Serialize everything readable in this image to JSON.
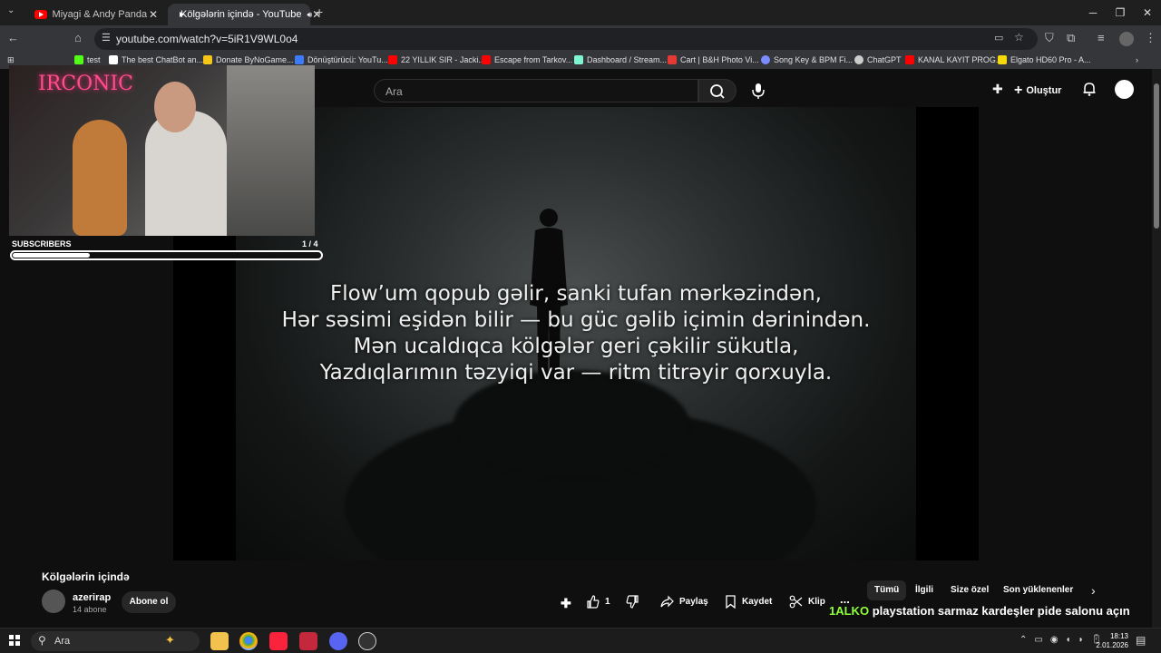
{
  "browser": {
    "tabs": [
      {
        "label": "Miyagi & Andy Panda - Minor |",
        "active": false
      },
      {
        "label": "Kölgələrin içində - YouTube",
        "active": true
      }
    ],
    "new_tab": "+",
    "url": "youtube.com/watch?v=5iR1V9WL0o4",
    "bookmarks": [
      {
        "label": "test",
        "icon": "kick-icon",
        "color": "#53fc18"
      },
      {
        "label": "The best ChatBot an...",
        "icon": "diamond-icon",
        "color": "#ffffff"
      },
      {
        "label": "Donate ByNoGame...",
        "icon": "bynogame-icon",
        "color": "#f5c518"
      },
      {
        "label": "Dönüştürücü: YouTu...",
        "icon": "converter-icon",
        "color": "#3d7bfd"
      },
      {
        "label": "22 YILLIK SIR - Jacki...",
        "icon": "youtube-icon",
        "color": "#ff0000"
      },
      {
        "label": "Escape from Tarkov...",
        "icon": "youtube-icon",
        "color": "#ff0000"
      },
      {
        "label": "Dashboard / Stream...",
        "icon": "streamlabs-icon",
        "color": "#80f5d2"
      },
      {
        "label": "Cart | B&H Photo Vi...",
        "icon": "bh-icon",
        "color": "#e53935"
      },
      {
        "label": "Song Key & BPM Fi...",
        "icon": "music-icon",
        "color": "#7a8cff"
      },
      {
        "label": "ChatGPT",
        "icon": "openai-icon",
        "color": "#cccccc"
      },
      {
        "label": "KANAL KAYIT PROG...",
        "icon": "youtube-icon",
        "color": "#ff0000"
      },
      {
        "label": "Elgato HD60 Pro - A...",
        "icon": "elgato-icon",
        "color": "#f5d90a"
      }
    ]
  },
  "youtube": {
    "search_placeholder": "Ara",
    "create_label": "Oluştur",
    "video": {
      "lyrics": [
        "Flow’um qopub gəlir, sanki tufan mərkəzindən,",
        "Hər səsimi eşidən bilir — bu güc gəlib içimin dərinindən.",
        "Mən ucaldıqca kölgələr geri çəkilir sükutla,",
        "Yazdıqlarımın təzyiqi var — ritm titrəyir qorxuyla."
      ]
    },
    "title": "Kölgələrin içində",
    "channel": {
      "name": "azerirap",
      "subscribers": "14 abone",
      "subscribe_label": "Abone ol"
    },
    "actions": {
      "likes": "1",
      "share": "Paylaş",
      "save": "Kaydet",
      "clip": "Klip",
      "more": "..."
    },
    "chips": [
      "Tümü",
      "İlgili",
      "Size özel",
      "Son yüklenenler"
    ]
  },
  "overlay": {
    "logo": "IRCONIC",
    "subscribers_label": "SUBSCRIBERS",
    "subscribers_count": "1 / 4",
    "progress_fraction": 0.25,
    "ticker_prefix": "1ALKO",
    "ticker_text": "playstation sarmaz kardeşler pide salonu açın"
  },
  "taskbar": {
    "search_text": "Ara",
    "time": "18:13",
    "date": "2.01.2026"
  }
}
